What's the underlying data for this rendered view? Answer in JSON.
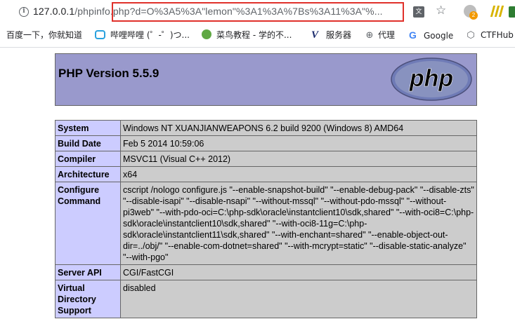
{
  "browser": {
    "url_host": "127.0.0.1",
    "url_path": "/phpinfo.php?d=O%3A5%3A\"lemon\"%3A1%3A%7Bs%3A11%3A\"%...",
    "extension_badge": "2",
    "bookmarks": [
      {
        "label": "百度一下，你就知道"
      },
      {
        "label": "哔哩哔哩 (゜-゜)つ..."
      },
      {
        "label": "菜鸟教程 - 学的不..."
      },
      {
        "label": "服务器"
      },
      {
        "label": "代理"
      },
      {
        "label": "Google"
      },
      {
        "label": "CTFHub"
      }
    ]
  },
  "phpinfo": {
    "version_title": "PHP Version 5.5.9",
    "logo_text": "php",
    "rows": [
      {
        "label": "System",
        "value": "Windows NT XUANJIANWEAPONS 6.2 build 9200 (Windows 8) AMD64"
      },
      {
        "label": "Build Date",
        "value": "Feb 5 2014 10:59:06"
      },
      {
        "label": "Compiler",
        "value": "MSVC11 (Visual C++ 2012)"
      },
      {
        "label": "Architecture",
        "value": "x64"
      },
      {
        "label": "Configure Command",
        "value": "cscript /nologo configure.js \"--enable-snapshot-build\" \"--enable-debug-pack\" \"--disable-zts\" \"--disable-isapi\" \"--disable-nsapi\" \"--without-mssql\" \"--without-pdo-mssql\" \"--without-pi3web\" \"--with-pdo-oci=C:\\php-sdk\\oracle\\instantclient10\\sdk,shared\" \"--with-oci8=C:\\php-sdk\\oracle\\instantclient10\\sdk,shared\" \"--with-oci8-11g=C:\\php-sdk\\oracle\\instantclient11\\sdk,shared\" \"--with-enchant=shared\" \"--enable-object-out-dir=../obj/\" \"--enable-com-dotnet=shared\" \"--with-mcrypt=static\" \"--disable-static-analyze\" \"--with-pgo\""
      },
      {
        "label": "Server API",
        "value": "CGI/FastCGI"
      },
      {
        "label": "Virtual Directory Support",
        "value": "disabled"
      }
    ]
  },
  "colors": {
    "header_bg": "#9999cc",
    "label_bg": "#ccccff",
    "value_bg": "#cccccc",
    "url_highlight": "#e0312b"
  }
}
